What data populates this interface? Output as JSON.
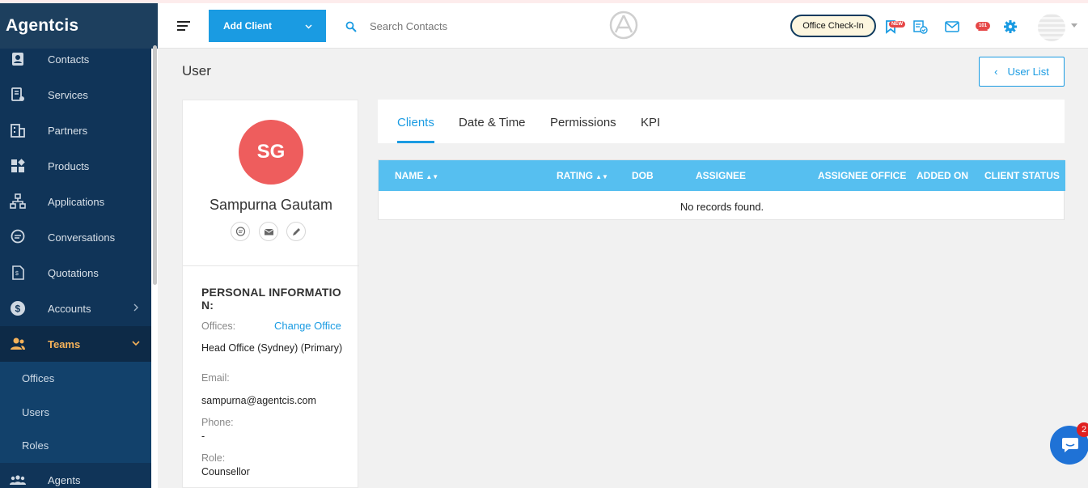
{
  "app": {
    "name": "Agentcis"
  },
  "sidebar": {
    "items": [
      {
        "label": "Contacts",
        "icon": "contacts-icon"
      },
      {
        "label": "Services",
        "icon": "services-icon"
      },
      {
        "label": "Partners",
        "icon": "partners-icon"
      },
      {
        "label": "Products",
        "icon": "products-icon"
      },
      {
        "label": "Applications",
        "icon": "applications-icon"
      },
      {
        "label": "Conversations",
        "icon": "conversations-icon"
      },
      {
        "label": "Quotations",
        "icon": "quotations-icon"
      },
      {
        "label": "Accounts",
        "icon": "accounts-icon"
      },
      {
        "label": "Teams",
        "icon": "teams-icon"
      }
    ],
    "subitems": [
      "Offices",
      "Users",
      "Roles"
    ],
    "last_item": {
      "label": "Agents",
      "icon": "agents-icon"
    }
  },
  "header": {
    "add_client_label": "Add Client",
    "search_placeholder": "Search Contacts",
    "office_checkin_label": "Office Check-In",
    "new_badge": "NEW",
    "count_badge": "101"
  },
  "page": {
    "title": "User",
    "user_list_label": "User List"
  },
  "profile": {
    "initials": "SG",
    "name": "Sampurna Gautam",
    "section_title": "PERSONAL INFORMATION:",
    "offices_label": "Offices:",
    "change_office_label": "Change Office",
    "office_value": "Head Office (Sydney) (Primary)",
    "email_label": "Email:",
    "email_value": "sampurna@agentcis.com",
    "phone_label": "Phone:",
    "phone_value": "-",
    "role_label": "Role:",
    "role_value": "Counsellor"
  },
  "tabs": [
    "Clients",
    "Date & Time",
    "Permissions",
    "KPI"
  ],
  "table": {
    "columns": [
      "NAME",
      "RATING",
      "DOB",
      "ASSIGNEE",
      "ASSIGNEE OFFICE",
      "ADDED ON",
      "CLIENT STATUS"
    ],
    "empty_text": "No records found."
  },
  "chat": {
    "badge": "2"
  },
  "colors": {
    "sidebar": "#103458",
    "accent": "#1a9be2",
    "table_header": "#56bff0",
    "avatar": "#ee5d5d",
    "active_nav": "#f5b25a"
  }
}
